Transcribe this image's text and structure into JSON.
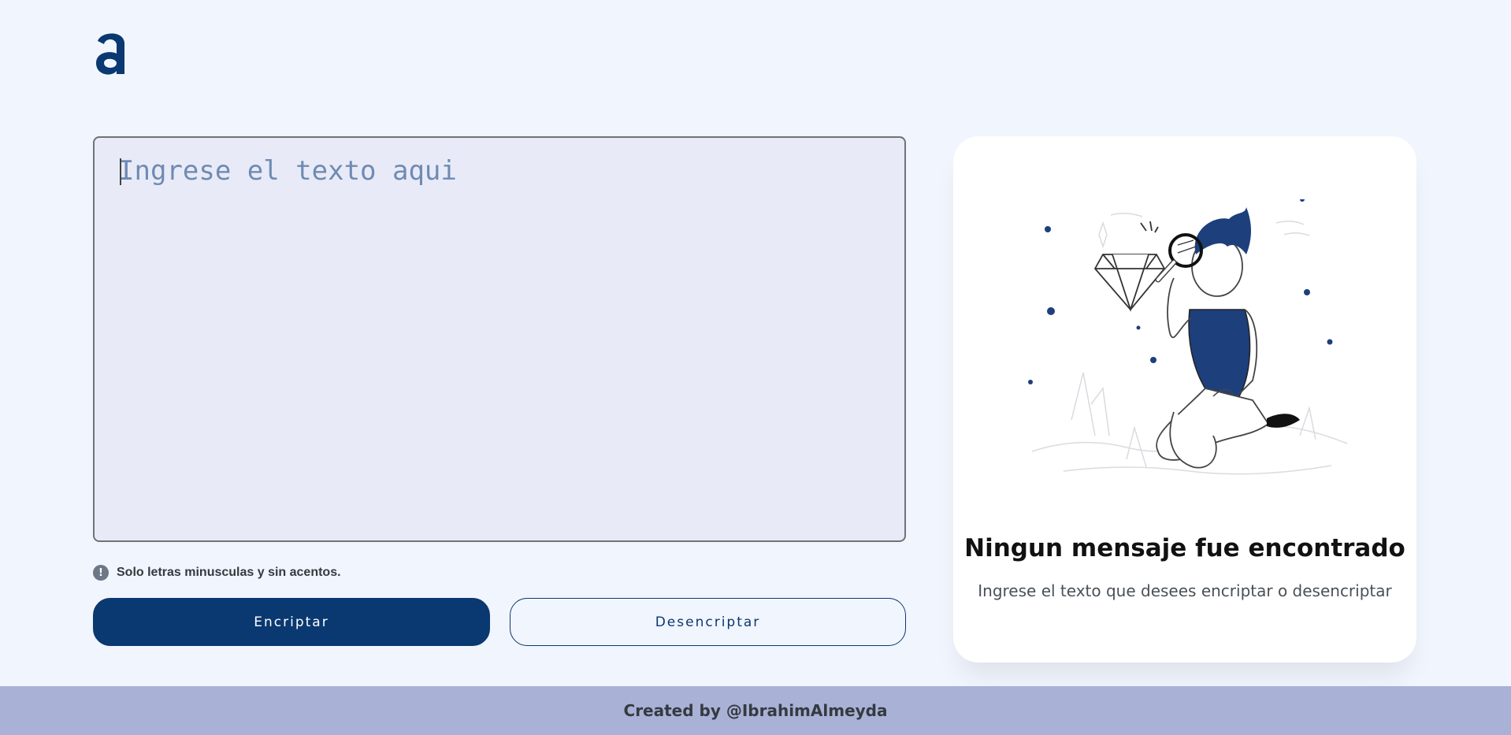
{
  "brand": {
    "logo_icon": "alura-logo-icon",
    "color": "#0a3871"
  },
  "editor": {
    "placeholder": "Ingrese el texto aqui",
    "value": ""
  },
  "hint": {
    "icon": "exclamation-icon",
    "text": "Solo letras minusculas y sin acentos."
  },
  "buttons": {
    "encrypt": "Encriptar",
    "decrypt": "Desencriptar"
  },
  "result": {
    "title": "Ningun mensaje fue encontrado",
    "subtitle": "Ingrese el texto que desees encriptar o desencriptar",
    "illustration_icon": "person-magnifying-glass-illustration"
  },
  "footer": {
    "text": "Created by @IbrahimAlmeyda"
  },
  "colors": {
    "background": "#f1f5fd",
    "primary": "#0a3871",
    "editor_bg": "#e8ebf7",
    "footer_bg": "#a9b1d6"
  }
}
